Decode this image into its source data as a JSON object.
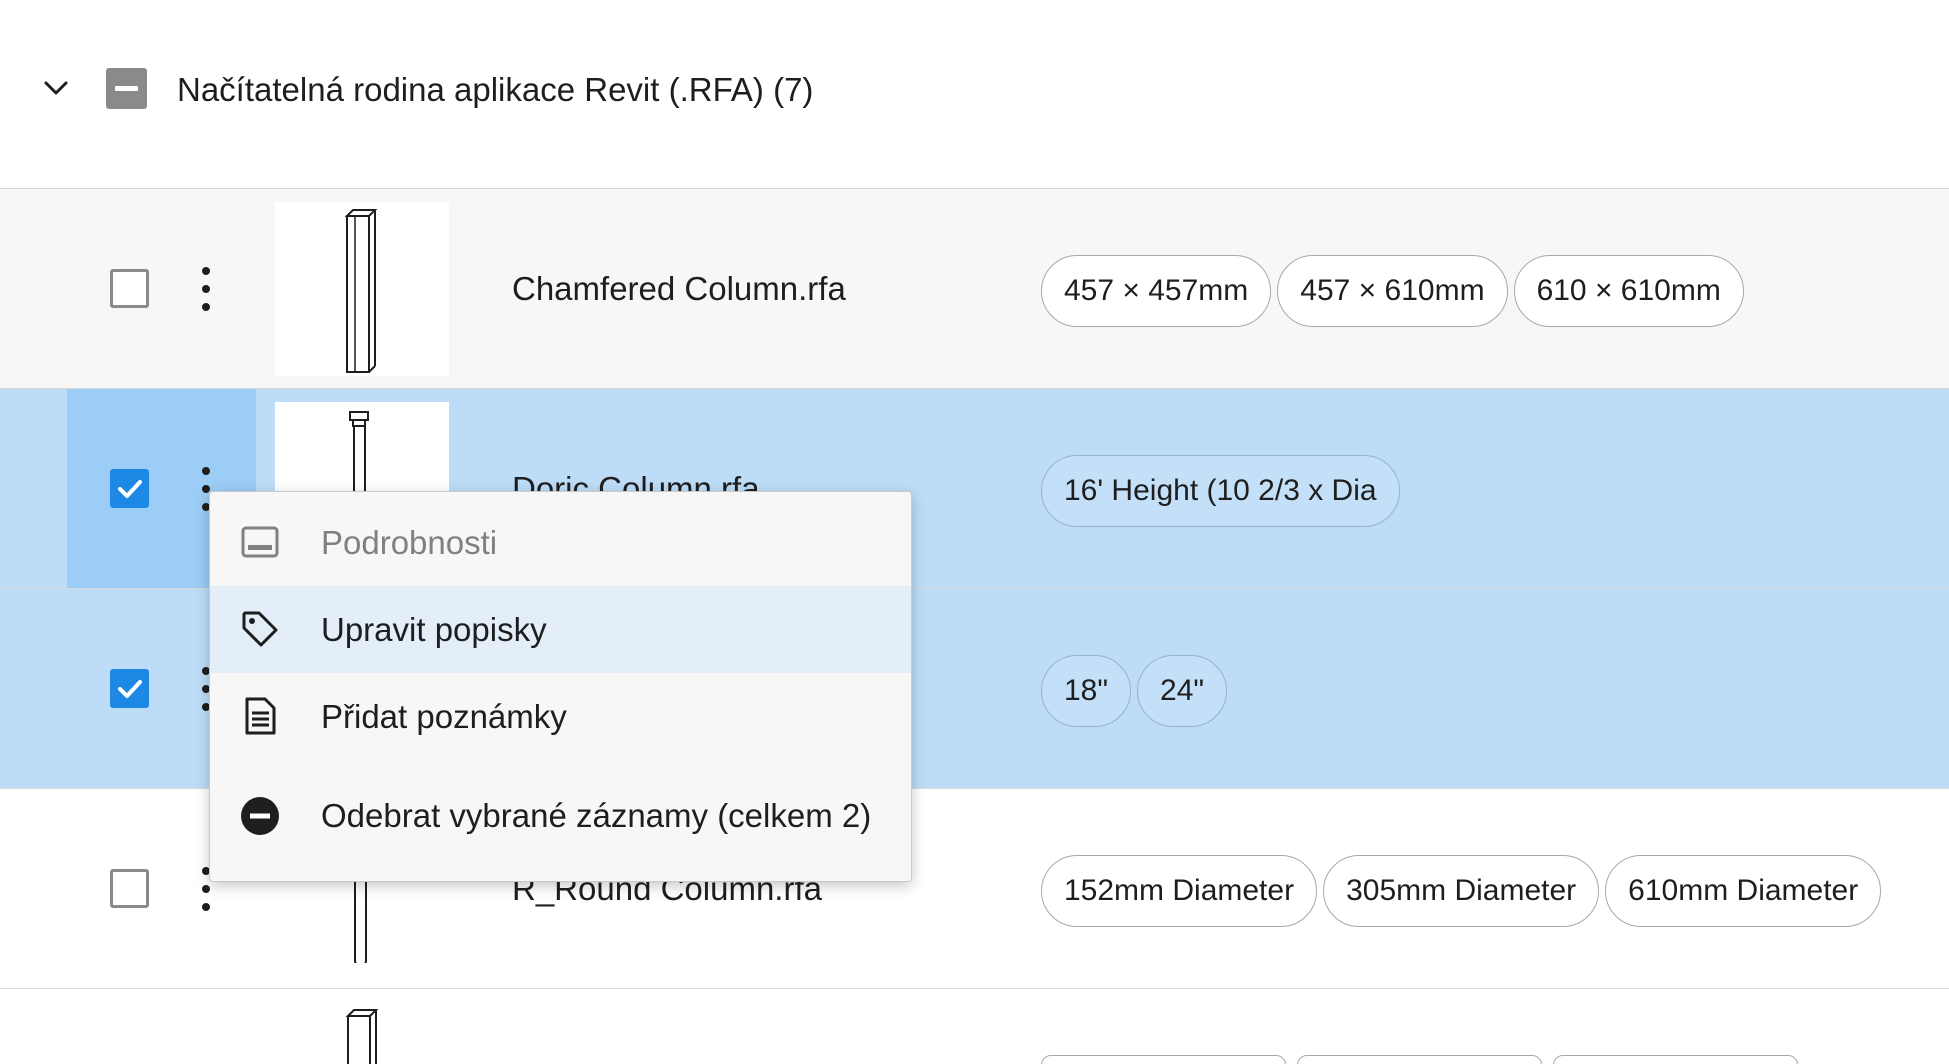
{
  "group": {
    "title": "Načítatelná rodina aplikace Revit (.RFA) (7)"
  },
  "rows": [
    {
      "name": "Chamfered Column.rfa",
      "checked": false,
      "tags": [
        "457 × 457mm",
        "457 × 610mm",
        "610 × 610mm"
      ]
    },
    {
      "name": "Doric Column.rfa",
      "checked": true,
      "tags": [
        "16' Height (10 2/3 x Dia"
      ]
    },
    {
      "name": "",
      "checked": true,
      "tags": [
        "18\"",
        "24\""
      ]
    },
    {
      "name": "R_Round Column.rfa",
      "checked": false,
      "tags": [
        "152mm Diameter",
        "305mm Diameter",
        "610mm Diameter"
      ]
    }
  ],
  "context_menu": {
    "items": [
      {
        "label": "Podrobnosti",
        "icon": "details-panel-icon",
        "disabled": true
      },
      {
        "label": "Upravit popisky",
        "icon": "tag-icon",
        "disabled": false,
        "hovered": true
      },
      {
        "label": "Přidat poznámky",
        "icon": "note-icon",
        "disabled": false
      },
      {
        "label": "Odebrat vybrané záznamy (celkem 2)",
        "icon": "remove-circle-icon",
        "disabled": false
      }
    ]
  },
  "colors": {
    "selected_row": "#bcdcf7",
    "selected_cell": "#9ccdf7",
    "checkbox_checked": "#1e88e5",
    "menu_hover": "#e3eef9"
  }
}
